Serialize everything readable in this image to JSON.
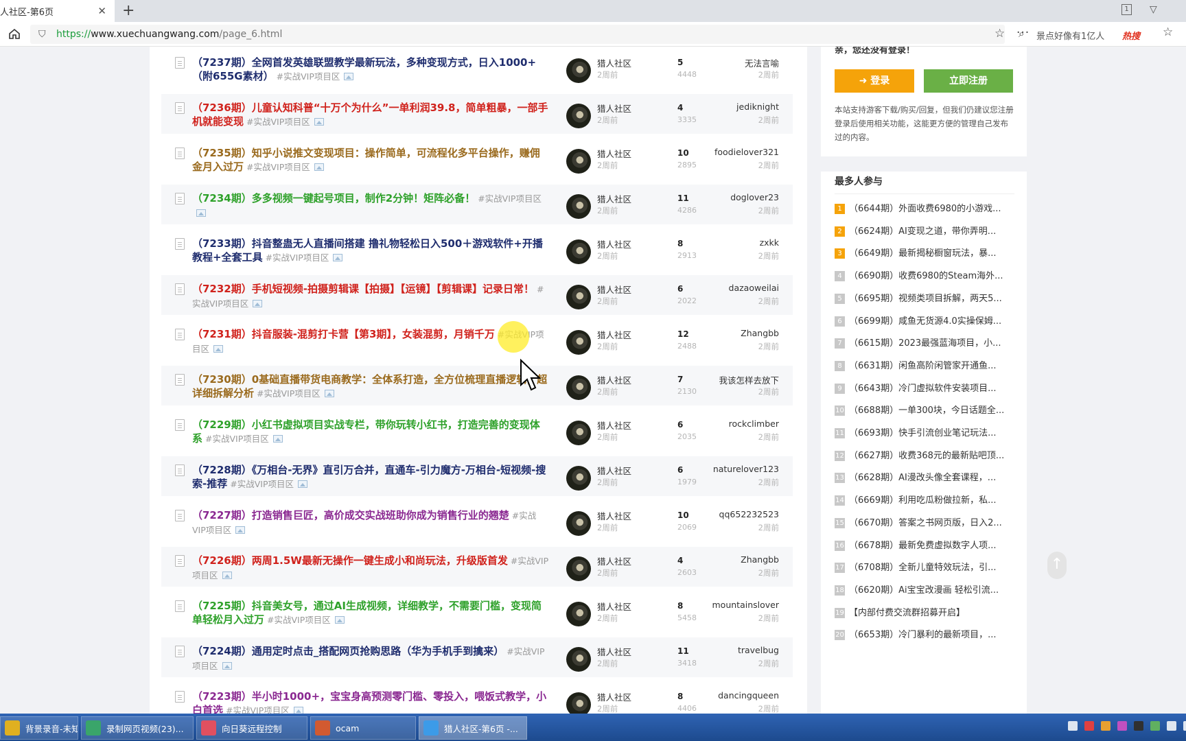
{
  "browser": {
    "tab_title": "人社区-第6页",
    "url_scheme": "https://",
    "url_host": "www.xuechuangwang.com",
    "url_path": "/page_6.html",
    "search_text": "景点好像有1亿人",
    "hot_label": "热搜",
    "tab_count_badge": "1"
  },
  "threads": [
    {
      "title": "（7237期）全网首发英雄联盟教学最新玩法，多种变现方式，日入1000+（附655G素材）",
      "color": "navy",
      "category": "#实战VIP项目区",
      "author": "猎人社区",
      "date": "2周前",
      "replies": "5",
      "views": "4448",
      "last_user": "无法言喻",
      "last_date": "2周前"
    },
    {
      "title": "（7236期）儿童认知科普“十万个为什么”一单利润39.8，简单粗暴，一部手机就能变现",
      "color": "red",
      "category": "#实战VIP项目区",
      "author": "猎人社区",
      "date": "2周前",
      "replies": "4",
      "views": "3335",
      "last_user": "jediknight",
      "last_date": "2周前"
    },
    {
      "title": "（7235期）知乎小说推文变现项目：操作简单，可流程化多平台操作，赚佣金月入过万",
      "color": "brown",
      "category": "#实战VIP项目区",
      "author": "猎人社区",
      "date": "2周前",
      "replies": "10",
      "views": "2895",
      "last_user": "foodielover321",
      "last_date": "2周前"
    },
    {
      "title": "（7234期）多多视频一键起号项目，制作2分钟！矩阵必备！",
      "color": "green",
      "category": "#实战VIP项目区",
      "author": "猎人社区",
      "date": "2周前",
      "replies": "11",
      "views": "4286",
      "last_user": "doglover23",
      "last_date": "2周前"
    },
    {
      "title": "（7233期）抖音整蛊无人直播间搭建 撸礼物轻松日入500＋游戏软件+开播教程+全套工具",
      "color": "navy",
      "category": "#实战VIP项目区",
      "author": "猎人社区",
      "date": "2周前",
      "replies": "8",
      "views": "2913",
      "last_user": "zxkk",
      "last_date": "2周前"
    },
    {
      "title": "（7232期）手机短视频-拍摄剪辑课【拍摄】【运镜】【剪辑课】记录日常！",
      "color": "red",
      "category": "#实战VIP项目区",
      "author": "猎人社区",
      "date": "2周前",
      "replies": "6",
      "views": "2022",
      "last_user": "dazaoweilai",
      "last_date": "2周前"
    },
    {
      "title": "（7231期）抖音服装-混剪打卡营【第3期】，女装混剪，月销千万",
      "color": "red",
      "category": "#实战VIP项目区",
      "author": "猎人社区",
      "date": "2周前",
      "replies": "12",
      "views": "2488",
      "last_user": "Zhangbb",
      "last_date": "2周前"
    },
    {
      "title": "（7230期）0基础直播带货电商教学：全体系打造，全方位梳理直播逻辑，超详细拆解分析",
      "color": "brown",
      "category": "#实战VIP项目区",
      "author": "猎人社区",
      "date": "2周前",
      "replies": "7",
      "views": "2130",
      "last_user": "我该怎样去放下",
      "last_date": "2周前"
    },
    {
      "title": "（7229期）小红书虚拟项目实战专栏，带你玩转小红书，打造完善的变现体系",
      "color": "green",
      "category": "#实战VIP项目区",
      "author": "猎人社区",
      "date": "2周前",
      "replies": "6",
      "views": "2035",
      "last_user": "rockclimber",
      "last_date": "2周前"
    },
    {
      "title": "（7228期）《万相台-无界》直引万合并，直通车-引力魔方-万相台-短视频-搜索-推荐",
      "color": "navy",
      "category": "#实战VIP项目区",
      "author": "猎人社区",
      "date": "2周前",
      "replies": "6",
      "views": "1979",
      "last_user": "naturelover123",
      "last_date": "2周前"
    },
    {
      "title": "（7227期）打造销售巨匠，高价成交实战班助你成为销售行业的翘楚",
      "color": "purple",
      "category": "#实战VIP项目区",
      "author": "猎人社区",
      "date": "2周前",
      "replies": "10",
      "views": "2069",
      "last_user": "qq652232523",
      "last_date": "2周前"
    },
    {
      "title": "（7226期）两周1.5W最新无操作一键生成小和尚玩法，升级版首发",
      "color": "red",
      "category": "#实战VIP项目区",
      "author": "猎人社区",
      "date": "2周前",
      "replies": "4",
      "views": "2603",
      "last_user": "Zhangbb",
      "last_date": "2周前"
    },
    {
      "title": "（7225期）抖音美女号，通过AI生成视频，详细教学，不需要门槛，变现简单轻松月入过万",
      "color": "green",
      "category": "#实战VIP项目区",
      "author": "猎人社区",
      "date": "2周前",
      "replies": "8",
      "views": "5458",
      "last_user": "mountainslover",
      "last_date": "2周前"
    },
    {
      "title": "（7224期）通用定时点击_搭配网页抢购思路（华为手机手到擒来）",
      "color": "navy",
      "category": "#实战VIP项目区",
      "author": "猎人社区",
      "date": "2周前",
      "replies": "11",
      "views": "3418",
      "last_user": "travelbug",
      "last_date": "2周前"
    },
    {
      "title": "（7223期）半小时1000+，宝宝身高预测零门槛、零投入，喂饭式教学，小白首选",
      "color": "purple",
      "category": "#实战VIP项目区",
      "author": "猎人社区",
      "date": "2周前",
      "replies": "8",
      "views": "4406",
      "last_user": "dancingqueen",
      "last_date": "2周前"
    }
  ],
  "sidebar": {
    "login_message": "亲，您还没有登录！",
    "login_button": "登录",
    "register_button": "立即注册",
    "login_note": "本站支持游客下载/购买/回复，但我们仍建议您注册登录后使用相关功能，这能更方便的管理自己发布过的内容。",
    "hot_title": "最多人参与",
    "hot_items": [
      {
        "rank": "1",
        "text": "（6644期）外面收费6980的小游戏..."
      },
      {
        "rank": "2",
        "text": "（6624期）AI变现之道，带你弄明..."
      },
      {
        "rank": "3",
        "text": "（6649期）最新揭秘橱窗玩法，暴..."
      },
      {
        "rank": "4",
        "text": "（6690期）收费6980的Steam海外..."
      },
      {
        "rank": "5",
        "text": "（6695期）视频类项目拆解，两天5..."
      },
      {
        "rank": "6",
        "text": "（6699期）咸鱼无货源4.0实操保姆..."
      },
      {
        "rank": "7",
        "text": "（6615期）2023最强蓝海项目，小..."
      },
      {
        "rank": "8",
        "text": "（6631期）闲鱼高阶闲管家开通鱼..."
      },
      {
        "rank": "9",
        "text": "（6643期）冷门虚拟软件安装项目..."
      },
      {
        "rank": "10",
        "text": "（6688期）一单300块，今日话题全..."
      },
      {
        "rank": "11",
        "text": "（6693期）快手引流创业笔记玩法..."
      },
      {
        "rank": "12",
        "text": "（6627期）收费368元的最新贴吧顶..."
      },
      {
        "rank": "13",
        "text": "（6628期）AI漫改头像全套课程，..."
      },
      {
        "rank": "14",
        "text": "（6669期）利用吃瓜粉做拉新，私..."
      },
      {
        "rank": "15",
        "text": "（6670期）答案之书网页版，日入2..."
      },
      {
        "rank": "16",
        "text": "（6678期）最新免费虚拟数字人项..."
      },
      {
        "rank": "17",
        "text": "（6708期）全新儿童特效玩法，引..."
      },
      {
        "rank": "18",
        "text": "（6620期）Ai宝宝改漫画 轻松引流..."
      },
      {
        "rank": "19",
        "text": "【内部付费交流群招募开启】"
      },
      {
        "rank": "20",
        "text": "（6653期）冷门暴利的最新项目，..."
      }
    ]
  },
  "back_to_top": "↑",
  "taskbar": {
    "items": [
      {
        "label": "背景录音-未知-酷...",
        "icon_color": "#e0b020"
      },
      {
        "label": "录制网页视频(23)...",
        "icon_color": "#3aa56a"
      },
      {
        "label": "向日葵远程控制",
        "icon_color": "#e05060"
      },
      {
        "label": "ocam",
        "icon_color": "#d25a30"
      },
      {
        "label": "猎人社区-第6页 -...",
        "icon_color": "#3c9be8"
      }
    ],
    "tray_colors": [
      "#dfe6f0",
      "#e04040",
      "#e8a030",
      "#c050c0",
      "#303030",
      "#60b060",
      "#dfe6f0",
      "#dfe6f0"
    ]
  }
}
